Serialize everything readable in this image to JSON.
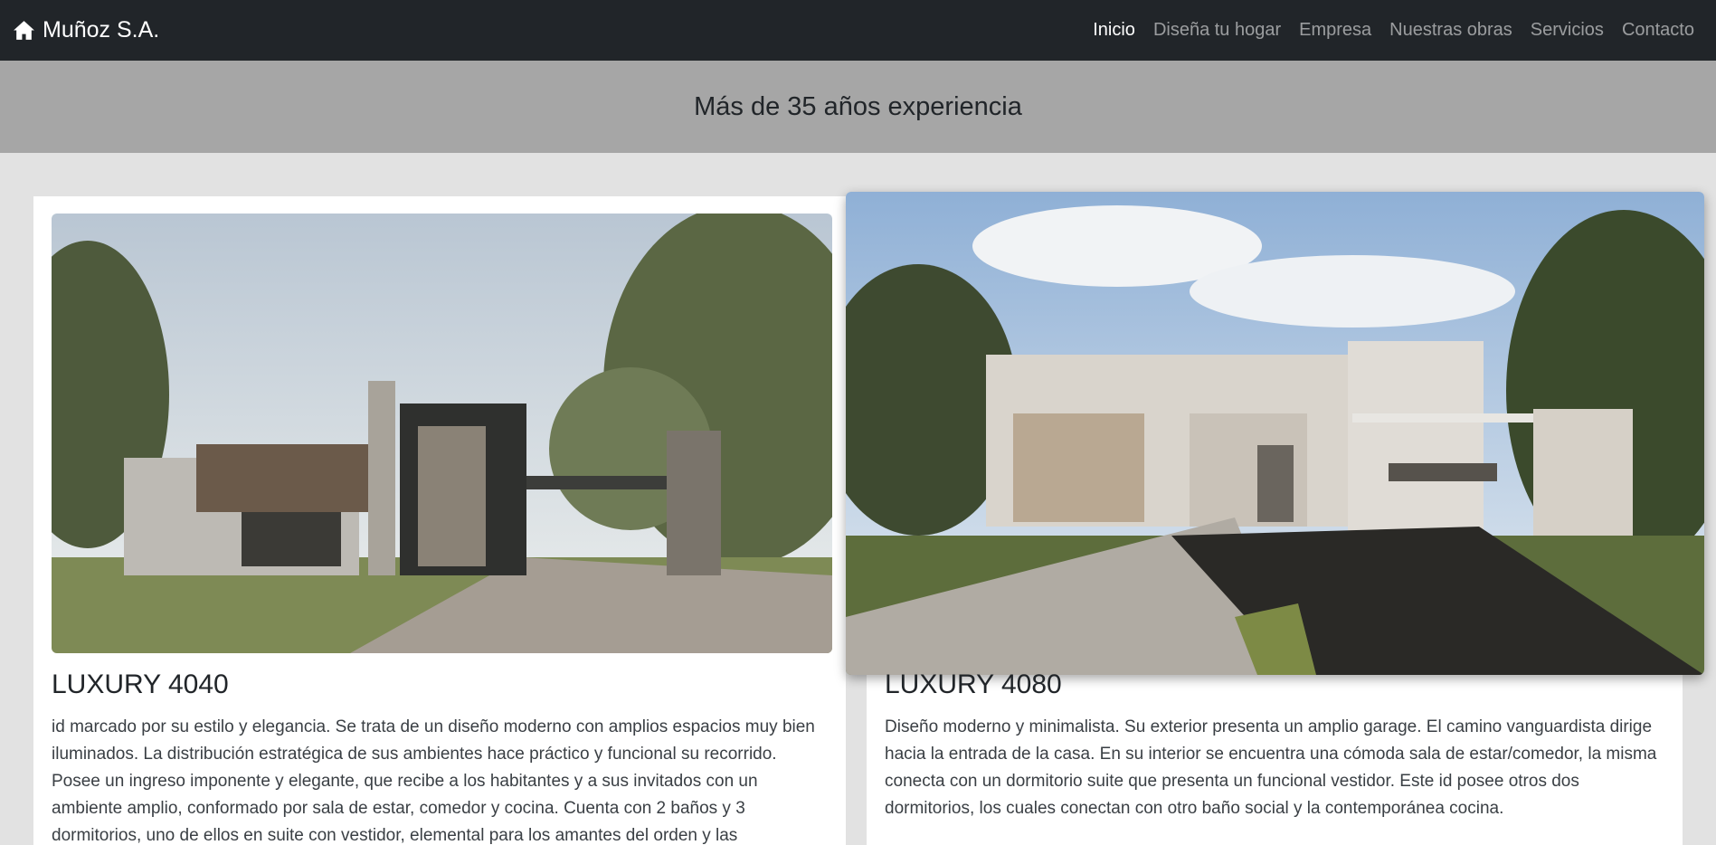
{
  "navbar": {
    "brand": "Muñoz S.A.",
    "links": [
      "Inicio",
      "Diseña tu hogar",
      "Empresa",
      "Nuestras obras",
      "Servicios",
      "Contacto"
    ],
    "active_index": 0
  },
  "hero": {
    "title": "Más de 35 años experiencia"
  },
  "cards": [
    {
      "title": "LUXURY 4040",
      "text": "id marcado por su estilo y elegancia. Se trata de un diseño moderno con amplios espacios muy bien iluminados. La distribución estratégica de sus ambientes hace práctico y funcional su recorrido. Posee un ingreso imponente y elegante, que recibe a los habitantes y a sus invitados con un ambiente amplio, conformado por sala de estar, comedor y cocina. Cuenta con 2 baños y 3 dormitorios, uno de ellos en suite con vestidor, elemental para los amantes del orden y las"
    },
    {
      "title": "LUXURY 4080",
      "text": "Diseño moderno y minimalista. Su exterior presenta un amplio garage. El camino vanguardista dirige hacia la entrada de la casa. En su interior se encuentra una cómoda sala de estar/comedor, la misma conecta con un dormitorio suite que presenta un funcional vestidor. Este id posee otros dos dormitorios, los cuales conectan con otro baño social y la contemporánea cocina."
    }
  ],
  "colors": {
    "navbar_bg": "#212529",
    "hero_bg": "#a6a6a6",
    "page_bg": "#e2e2e2"
  },
  "icons": {
    "brand": "home-icon"
  }
}
